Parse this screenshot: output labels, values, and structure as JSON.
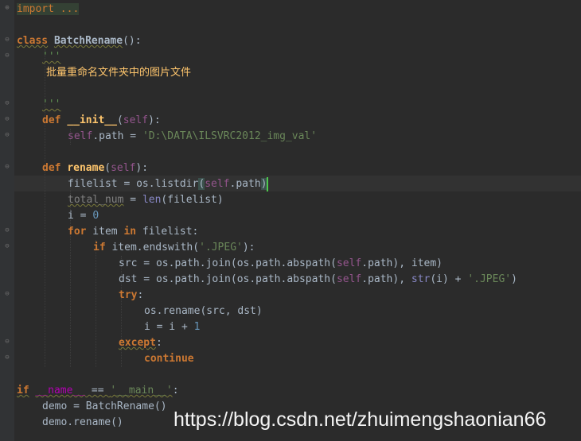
{
  "editor": {
    "lines": {
      "l1": {
        "import_kw": "import",
        "dots": " ..."
      },
      "l3": {
        "class_kw": "class",
        "class_name": "BatchRename",
        "parens": "():"
      },
      "l4": {
        "doc_open": "'''"
      },
      "l5": {
        "doc_text": "批量重命名文件夹中的图片文件"
      },
      "l7": {
        "doc_close": "'''"
      },
      "l8": {
        "def_kw": "def",
        "fn_name": "__init__",
        "open": "(",
        "self": "self",
        "close": "):"
      },
      "l9": {
        "self": "self",
        "attr": ".path = ",
        "value": "'D:\\DATA\\ILSVRC2012_img_val'"
      },
      "l11": {
        "def_kw": "def",
        "fn_name": "rename",
        "open": "(",
        "self": "self",
        "close": "):"
      },
      "l12": {
        "pre": "filelist = os.listdir",
        "open": "(",
        "self": "self",
        "attr": ".path",
        "close": ")"
      },
      "l13": {
        "var": "total_num",
        "mid": " = ",
        "builtin": "len",
        "rest": "(filelist)"
      },
      "l14": {
        "pre": "i = ",
        "num": "0"
      },
      "l15": {
        "for_kw": "for",
        "mid": " item ",
        "in_kw": "in",
        "rest": " filelist:"
      },
      "l16": {
        "if_kw": "if",
        "pre": " item.endswith(",
        "str": "'.JPEG'",
        "close": "):"
      },
      "l17": {
        "pre": "src = os.path.join(os.path.abspath(",
        "self": "self",
        "attr": ".path",
        "close": "), item)"
      },
      "l18": {
        "pre": "dst = os.path.join(os.path.abspath(",
        "self": "self",
        "attr": ".path",
        "mid": "), ",
        "builtin": "str",
        "mid2": "(i) + ",
        "str": "'.JPEG'",
        "close": ")"
      },
      "l19": {
        "try_kw": "try",
        "colon": ":"
      },
      "l20": {
        "text": "os.rename(src, dst)"
      },
      "l21": {
        "pre": "i = i + ",
        "num": "1"
      },
      "l22": {
        "except_kw": "except",
        "colon": ":"
      },
      "l23": {
        "continue_kw": "continue"
      },
      "l25": {
        "if_kw": "if",
        "sp": " ",
        "dunder": "__name__",
        "eq": " == ",
        "str": "'__main__'",
        "colon": ":"
      },
      "l26": {
        "pre": "demo = ",
        "cls": "BatchRename",
        "close": "()"
      },
      "l27": {
        "text": "demo.rename()"
      }
    }
  },
  "watermark": {
    "text": "https://blog.csdn.net/zhuimengshaonian66"
  }
}
